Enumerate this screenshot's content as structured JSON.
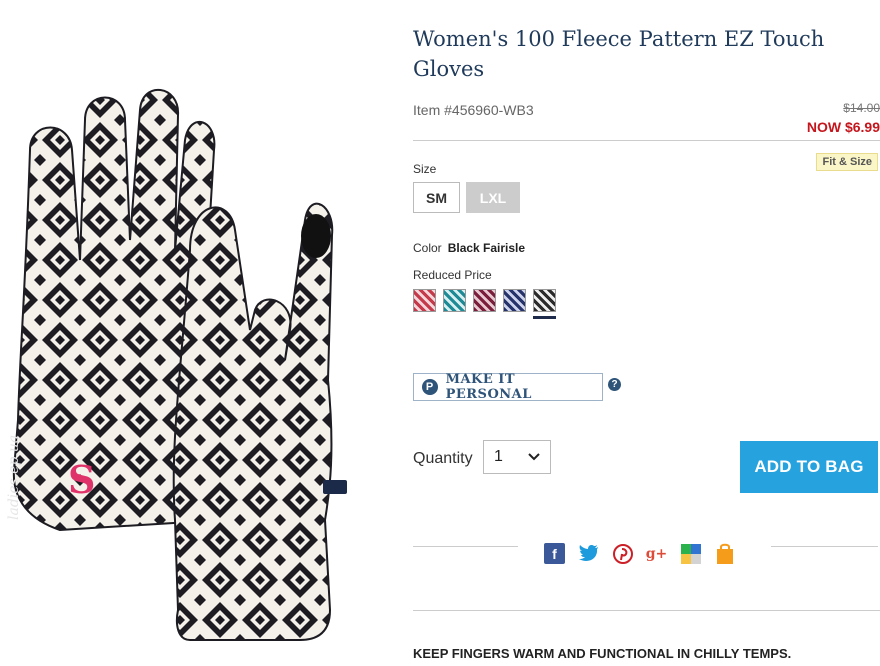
{
  "product": {
    "title": "Women's 100 Fleece Pattern EZ Touch Gloves",
    "item_number": "Item #456960-WB3",
    "price_original": "$14.00",
    "price_now": "NOW $6.99"
  },
  "watermark_text": "ladies.ep.ua",
  "size": {
    "label": "Size",
    "fit_link": "Fit & Size",
    "options": [
      "SM",
      "LXL"
    ]
  },
  "color": {
    "label": "Color",
    "value": "Black Fairisle",
    "reduced_label": "Reduced Price",
    "swatches": [
      {
        "name": "red fairisle",
        "color": "#c43a4a"
      },
      {
        "name": "teal fairisle",
        "color": "#1d8a96"
      },
      {
        "name": "burgundy fairisle",
        "color": "#7a1e3c"
      },
      {
        "name": "navy fairisle",
        "color": "#26336a"
      },
      {
        "name": "black fairisle",
        "color": "#2a2a2a"
      }
    ]
  },
  "personalize": {
    "icon": "P",
    "label": "MAKE IT PERSONAL",
    "help": "?"
  },
  "quantity": {
    "label": "Quantity",
    "value": "1"
  },
  "add_to_bag": "ADD TO BAG",
  "social_icons": [
    "facebook-icon",
    "twitter-icon",
    "pinterest-icon",
    "google-plus-icon",
    "delicious-icon",
    "shopping-bag-icon"
  ],
  "social": {
    "facebook": "f",
    "google": "g+"
  },
  "description_heading": "KEEP FINGERS WARM AND FUNCTIONAL IN CHILLY TEMPS.",
  "colors": {
    "title": "#1f3a5a",
    "sale_red": "#c4161c",
    "accent_blue": "#26a2df",
    "monogram_pink": "#e0326a"
  },
  "monogram": "S"
}
